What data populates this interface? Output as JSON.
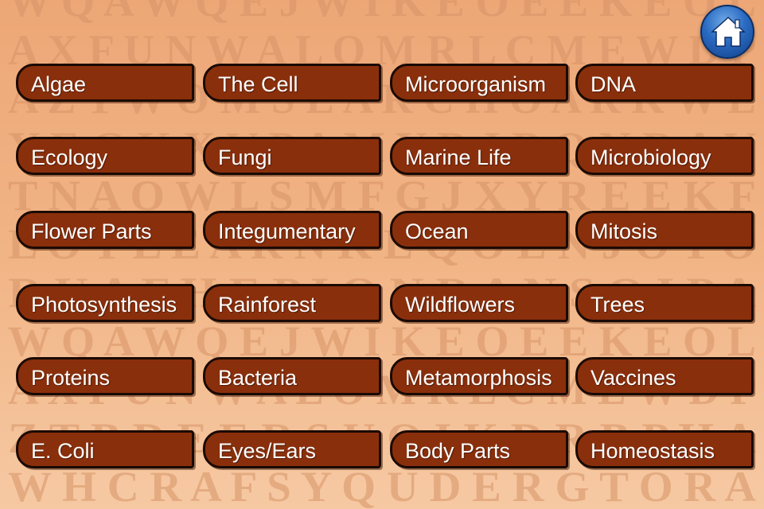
{
  "home_button": {
    "icon": "home-icon",
    "color": "#2a6bc2"
  },
  "background_letters": [
    "W Q A W Q E J W I K E O E E K E O L",
    "A X F U N W A L O M R L C M E W D P",
    "A Z T W O M S E A R C H O A R K W E",
    "Y E G K X V P A M Y B J B Q N R A V",
    "T N A O W L S M F G J X Y R E E K F",
    "L O T L E A R N K E Q O E N J O Y O",
    "R U A F H E P I O N R A N S Q I P A",
    "W Q A W Q E J W I K E O E E K E O L",
    "A X F U N W A L O M R L C M E W D P",
    "Z T B D E E R S U Q I K D R B P H A",
    "W H C R A F S Y Q U D E R G T O R A"
  ],
  "topics": [
    "Algae",
    "The Cell",
    "Microorganism",
    "DNA",
    "Ecology",
    "Fungi",
    "Marine Life",
    "Microbiology",
    "Flower Parts",
    "Integumentary",
    "Ocean",
    "Mitosis",
    "Photosynthesis",
    "Rainforest",
    "Wildflowers",
    "Trees",
    "Proteins",
    "Bacteria",
    "Metamorphosis",
    "Vaccines",
    "E. Coli",
    "Eyes/Ears",
    "Body Parts",
    "Homeostasis"
  ],
  "colors": {
    "button_fill": "#8a2f0c",
    "button_border": "#1a0a04",
    "label": "#ffffff"
  }
}
